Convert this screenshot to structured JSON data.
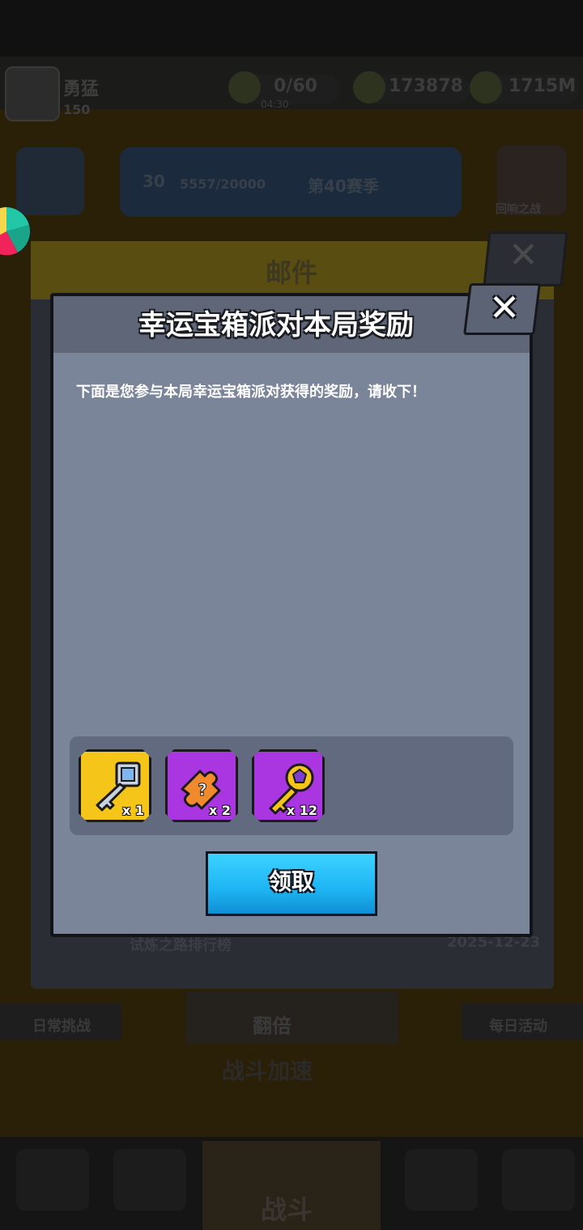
{
  "header": {
    "player_name": "勇猛",
    "player_level": "150",
    "energy": "0/60",
    "energy_timer": "04:30",
    "coins": "173878",
    "gems": "1715M"
  },
  "season": {
    "level": "30",
    "progress": "5557/20000",
    "rank_label": "第40赛季"
  },
  "side_button_label": "回响之战",
  "mail": {
    "title": "邮件",
    "item_title": "试炼之路排行榜",
    "item_date": "2025-12-23"
  },
  "bottom": {
    "daily_challenge": "日常挑战",
    "mid_button": "翻倍",
    "daily_event": "每日活动",
    "speed_label": "战斗加速",
    "battle_label": "战斗"
  },
  "dialog": {
    "title": "幸运宝箱派对本局奖励",
    "close_symbol": "✕",
    "message": "下面是您参与本局幸运宝箱派对获得的奖励，请收下！",
    "rewards": [
      {
        "name": "silver-key",
        "count": "x 1",
        "rarity": "gold"
      },
      {
        "name": "puzzle-piece",
        "count": "x 2",
        "rarity": "purple"
      },
      {
        "name": "gold-key",
        "count": "x 12",
        "rarity": "purple"
      }
    ],
    "claim_label": "领取"
  },
  "colors": {
    "dialog_bg": "#7b8599",
    "claim_button": "#1eb4f4",
    "gold_frame": "#f5c51a",
    "purple_frame": "#a936e0"
  }
}
